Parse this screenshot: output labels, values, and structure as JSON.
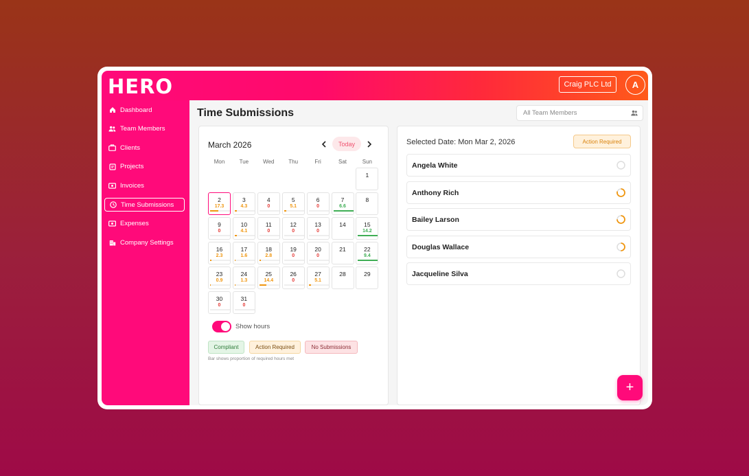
{
  "header": {
    "logo": "HERO",
    "company": "Craig PLC Ltd",
    "avatar_initial": "A"
  },
  "sidebar": {
    "items": [
      {
        "label": "Dashboard",
        "icon": "home-icon"
      },
      {
        "label": "Team Members",
        "icon": "users-icon"
      },
      {
        "label": "Clients",
        "icon": "briefcase-icon"
      },
      {
        "label": "Projects",
        "icon": "clipboard-icon"
      },
      {
        "label": "Invoices",
        "icon": "money-icon"
      },
      {
        "label": "Time Submissions",
        "icon": "clock-icon",
        "active": true
      },
      {
        "label": "Expenses",
        "icon": "money-icon"
      },
      {
        "label": "Company Settings",
        "icon": "building-icon"
      }
    ]
  },
  "main": {
    "title": "Time Submissions",
    "member_filter_placeholder": "All Team Members"
  },
  "calendar": {
    "month": "March 2026",
    "today_label": "Today",
    "weekdays": [
      "Mon",
      "Tue",
      "Wed",
      "Thu",
      "Fri",
      "Sat",
      "Sun"
    ],
    "days": [
      {
        "day": "1",
        "col": 6,
        "row": 0,
        "hours": "",
        "fill": 0,
        "status": "none"
      },
      {
        "day": "2",
        "col": 0,
        "row": 1,
        "hours": "17.3",
        "fill": 0.4,
        "status": "action",
        "selected": true
      },
      {
        "day": "3",
        "col": 1,
        "row": 1,
        "hours": "4.3",
        "fill": 0.1,
        "status": "action"
      },
      {
        "day": "4",
        "col": 2,
        "row": 1,
        "hours": "0",
        "fill": 0,
        "status": "nosub"
      },
      {
        "day": "5",
        "col": 3,
        "row": 1,
        "hours": "5.1",
        "fill": 0.12,
        "status": "action"
      },
      {
        "day": "6",
        "col": 4,
        "row": 1,
        "hours": "0",
        "fill": 0,
        "status": "nosub"
      },
      {
        "day": "7",
        "col": 5,
        "row": 1,
        "hours": "6.6",
        "fill": 1,
        "status": "compliant"
      },
      {
        "day": "8",
        "col": 6,
        "row": 1,
        "hours": "",
        "fill": 0,
        "status": "none"
      },
      {
        "day": "9",
        "col": 0,
        "row": 2,
        "hours": "0",
        "fill": 0,
        "status": "nosub"
      },
      {
        "day": "10",
        "col": 1,
        "row": 2,
        "hours": "4.1",
        "fill": 0.1,
        "status": "action"
      },
      {
        "day": "11",
        "col": 2,
        "row": 2,
        "hours": "0",
        "fill": 0,
        "status": "nosub"
      },
      {
        "day": "12",
        "col": 3,
        "row": 2,
        "hours": "0",
        "fill": 0,
        "status": "nosub"
      },
      {
        "day": "13",
        "col": 4,
        "row": 2,
        "hours": "0",
        "fill": 0,
        "status": "nosub"
      },
      {
        "day": "14",
        "col": 5,
        "row": 2,
        "hours": "",
        "fill": 0,
        "status": "none"
      },
      {
        "day": "15",
        "col": 6,
        "row": 2,
        "hours": "14.2",
        "fill": 1,
        "status": "compliant"
      },
      {
        "day": "16",
        "col": 0,
        "row": 3,
        "hours": "2.3",
        "fill": 0.06,
        "status": "action"
      },
      {
        "day": "17",
        "col": 1,
        "row": 3,
        "hours": "1.6",
        "fill": 0.04,
        "status": "action"
      },
      {
        "day": "18",
        "col": 2,
        "row": 3,
        "hours": "2.8",
        "fill": 0.07,
        "status": "action"
      },
      {
        "day": "19",
        "col": 3,
        "row": 3,
        "hours": "0",
        "fill": 0,
        "status": "nosub"
      },
      {
        "day": "20",
        "col": 4,
        "row": 3,
        "hours": "0",
        "fill": 0,
        "status": "nosub"
      },
      {
        "day": "21",
        "col": 5,
        "row": 3,
        "hours": "",
        "fill": 0,
        "status": "none"
      },
      {
        "day": "22",
        "col": 6,
        "row": 3,
        "hours": "9.4",
        "fill": 1,
        "status": "compliant"
      },
      {
        "day": "23",
        "col": 0,
        "row": 4,
        "hours": "0.9",
        "fill": 0.03,
        "status": "action"
      },
      {
        "day": "24",
        "col": 1,
        "row": 4,
        "hours": "1.3",
        "fill": 0.04,
        "status": "action"
      },
      {
        "day": "25",
        "col": 2,
        "row": 4,
        "hours": "14.4",
        "fill": 0.35,
        "status": "action"
      },
      {
        "day": "26",
        "col": 3,
        "row": 4,
        "hours": "0",
        "fill": 0,
        "status": "nosub"
      },
      {
        "day": "27",
        "col": 4,
        "row": 4,
        "hours": "5.1",
        "fill": 0.12,
        "status": "action"
      },
      {
        "day": "28",
        "col": 5,
        "row": 4,
        "hours": "",
        "fill": 0,
        "status": "none"
      },
      {
        "day": "29",
        "col": 6,
        "row": 4,
        "hours": "",
        "fill": 0,
        "status": "none"
      },
      {
        "day": "30",
        "col": 0,
        "row": 5,
        "hours": "0",
        "fill": 0,
        "status": "nosub"
      },
      {
        "day": "31",
        "col": 1,
        "row": 5,
        "hours": "0",
        "fill": 0,
        "status": "nosub"
      }
    ],
    "show_hours_label": "Show hours",
    "legend": {
      "compliant": "Compliant",
      "action": "Action Required",
      "nosub": "No Submissions",
      "note": "Bar shows proportion of required hours met"
    }
  },
  "colors": {
    "compliant": "#3fae55",
    "action": "#f0960f",
    "nosub": "#e53935",
    "accent": "#ff0a7a"
  },
  "details": {
    "selected_date": "Selected Date: Mon Mar 2, 2026",
    "status_badge": "Action Required",
    "members": [
      {
        "name": "Angela White",
        "progress": 0
      },
      {
        "name": "Anthony Rich",
        "progress": 0.8
      },
      {
        "name": "Bailey Larson",
        "progress": 0.75
      },
      {
        "name": "Douglas Wallace",
        "progress": 0.5
      },
      {
        "name": "Jacqueline Silva",
        "progress": 0
      }
    ]
  },
  "fab_label": "+"
}
